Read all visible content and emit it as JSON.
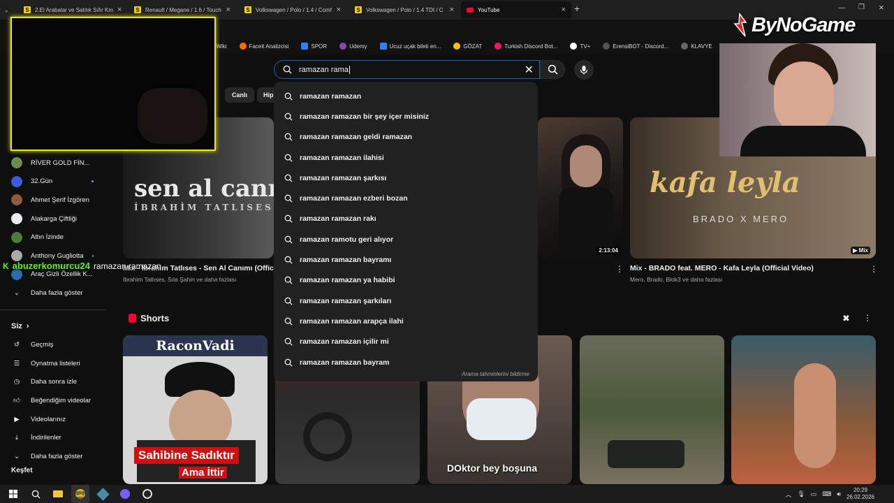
{
  "tabs": [
    {
      "label": "2.El Arabalar ve Satılık Sıfır Km"
    },
    {
      "label": "Renault / Megane / 1.6 / Touch"
    },
    {
      "label": "Volkswagen / Polo / 1.4 / Comf"
    },
    {
      "label": "Volkswagen / Polo / 1.4 TDI / C"
    },
    {
      "label": "YouTube"
    }
  ],
  "bookmarks": [
    "eWiki",
    "Faceit Analizcisi",
    "SPOR",
    "Udemy",
    "Ucuz uçak bileti en...",
    "GÖZAT",
    "Turkish Discord Bot...",
    "TV+",
    "ErensiBOT - Discord...",
    "KLAVYE"
  ],
  "watermark": "ByNoGame",
  "search": {
    "value": "ramazan rama"
  },
  "suggestions": [
    "ramazan ramazan",
    "ramazan ramazan bir şey içer misiniz",
    "ramazan ramazan geldi ramazan",
    "ramazan ramazan ilahisi",
    "ramazan ramazan şarkısı",
    "ramazan ramazan ezberi bozan",
    "ramazan ramazan rakı",
    "ramazan ramotu geri alıyor",
    "ramazan ramazan bayramı",
    "ramazan ramazan ya habibi",
    "ramazan ramazan şarkıları",
    "ramazan ramazan arapça ilahi",
    "ramazan ramazan içilir mi",
    "ramazan ramazan bayram"
  ],
  "suggestions_report": "Arama tahminlerini bildirme",
  "chips": [
    "Canlı",
    "Hip"
  ],
  "subscriptions": [
    {
      "label": "RİVER GOLD FİN...",
      "color": "#6b8e4e"
    },
    {
      "label": "32.Gün",
      "color": "#3b5bdb"
    },
    {
      "label": "Ahmet Şerif İzgören",
      "color": "#8d5a3b"
    },
    {
      "label": "Alakarga Çiftliği",
      "color": "#e9ecef"
    },
    {
      "label": "Altın İzinde",
      "color": "#4d7c3a"
    },
    {
      "label": "Anthony Gugliotta",
      "color": "#aaaaaa"
    },
    {
      "label": "Araç Gizli Özellik K...",
      "color": "#2b6cb0"
    }
  ],
  "show_more": "Daha fazla göster",
  "you_section": "Siz",
  "you_items": [
    "Geçmiş",
    "Oynatma listeleri",
    "Daha sonra izle",
    "Beğendiğim videolar",
    "Videolarınız",
    "İndirilenler",
    "Daha fazla göster"
  ],
  "keşfet": "Keşfet",
  "chat": {
    "user": "abuzerkomurcu24",
    "message": "ramazan ramazan"
  },
  "videos": [
    {
      "thumb_text1": "sen al canım",
      "thumb_text2": "İBRAHİM TATLISES",
      "title": "Mix - İbrahim Tatlıses - Sen Al Canımı (Officia",
      "sub": "İbrahim Tatlıses, Sıla Şahin ve daha fazlası"
    },
    {
      "duration": "2:13:04"
    },
    {
      "thumb_text1": "kafa leyla",
      "thumb_text2": "BRADO X MERO",
      "badge": "Mix",
      "title": "Mix - BRADO feat. MERO - Kafa Leyla (Official Video)",
      "sub": "Mero, Brado, Blok3 ve daha fazlası"
    }
  ],
  "shorts_label": "Shorts",
  "shorts": [
    {
      "top": "RaconVadi",
      "bottom1": "Sahibine Sadıktır",
      "bottom2": "Ama İttir"
    },
    {
      "top": ""
    },
    {
      "caption": "DOktor bey boşuna"
    },
    {
      "top": ""
    },
    {
      "top": ""
    }
  ],
  "clock": {
    "time": "20:29",
    "date": "26.02.2026"
  }
}
